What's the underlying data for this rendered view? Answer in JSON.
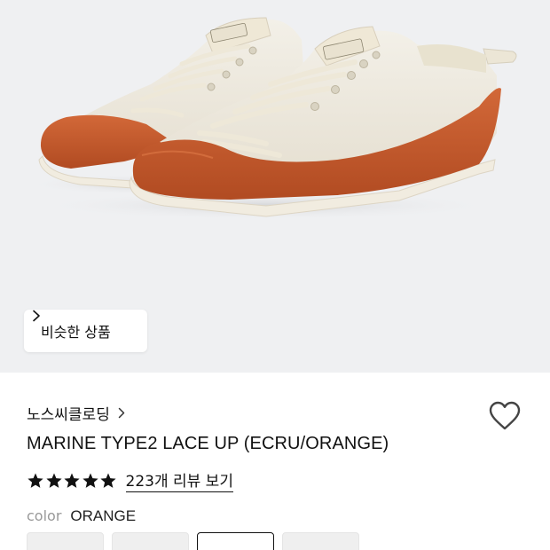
{
  "similar_products": {
    "label": "비슷한 상품"
  },
  "product": {
    "brand": "노스씨클로딩",
    "title": "MARINE TYPE2 LACE UP (ECRU/ORANGE)",
    "rating": 5,
    "review_link": "223개 리뷰 보기",
    "color_label": "color",
    "color_value": "ORANGE",
    "swatches": [
      {
        "selected": false
      },
      {
        "selected": false
      },
      {
        "selected": true
      },
      {
        "selected": false
      }
    ]
  },
  "colors": {
    "hero_background": "#eff0f2",
    "canvas": "#eeeae0",
    "rubber": "#c85a2d",
    "sole": "#f1ece0"
  },
  "icons": {
    "heart": "heart-icon",
    "chevron": "chevron-right-icon",
    "star": "star-icon"
  }
}
